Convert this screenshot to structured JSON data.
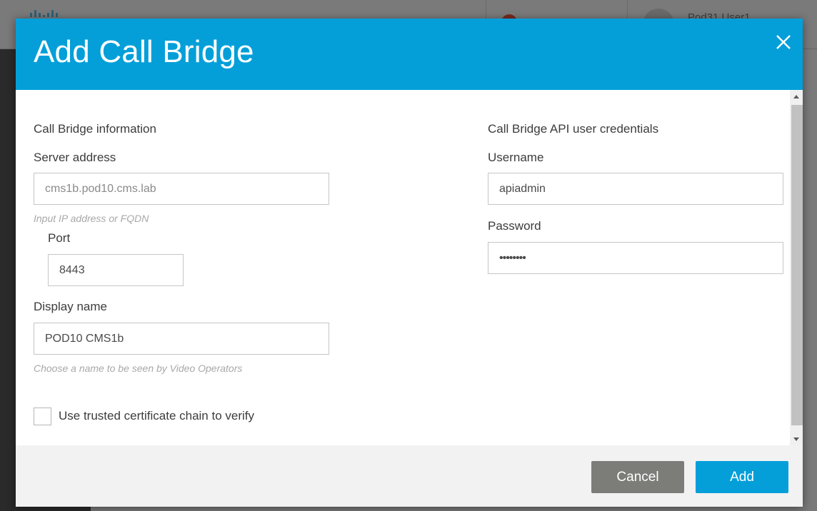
{
  "background": {
    "user_name": "Pod31 User1"
  },
  "dialog": {
    "title": "Add Call Bridge",
    "close_icon": "close-icon"
  },
  "bridge_info": {
    "section_title": "Call Bridge information",
    "server_address_label": "Server address",
    "server_address_value": "cms1b.pod10.cms.lab",
    "server_address_hint": "Input IP address or FQDN",
    "port_label": "Port",
    "port_value": "8443",
    "display_name_label": "Display name",
    "display_name_value": "POD10 CMS1b",
    "display_name_hint": "Choose a name to be seen by Video Operators",
    "trusted_chain_label": "Use trusted certificate chain to verify",
    "trusted_chain_checked": false
  },
  "credentials": {
    "section_title": "Call Bridge API user credentials",
    "username_label": "Username",
    "username_value": "apiadmin",
    "password_label": "Password",
    "password_value": "••••••••"
  },
  "footer": {
    "cancel_label": "Cancel",
    "add_label": "Add"
  },
  "colors": {
    "header_blue": "#049fd9",
    "cancel_gray": "#7c7c78",
    "add_blue": "#049fd9"
  }
}
